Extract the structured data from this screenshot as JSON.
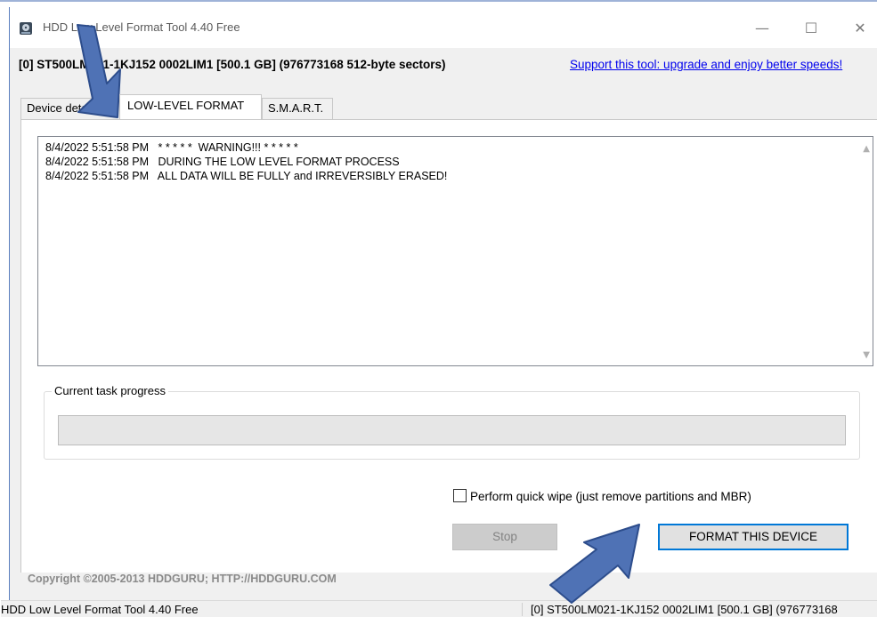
{
  "window": {
    "title": "HDD Low Level Format Tool 4.40   Free",
    "minimize": "—",
    "maximize": "☐",
    "close": "✕"
  },
  "device_info": {
    "text": "[0]  ST500LM021-1KJ152   0002LIM1   [500.1 GB]   (976773168 512-byte sectors)",
    "support_link": "Support this tool: upgrade and enjoy better speeds!"
  },
  "tabs": [
    {
      "label": "Device details"
    },
    {
      "label": "LOW-LEVEL FORMAT"
    },
    {
      "label": "S.M.A.R.T."
    }
  ],
  "log": {
    "lines": [
      "8/4/2022 5:51:58 PM   * * * * *  WARNING!!! * * * * *",
      "8/4/2022 5:51:58 PM   DURING THE LOW LEVEL FORMAT PROCESS",
      "8/4/2022 5:51:58 PM   ALL DATA WILL BE FULLY and IRREVERSIBLY ERASED!"
    ]
  },
  "progress": {
    "label": "Current task progress",
    "value_percent": 0
  },
  "options": {
    "quick_wipe_label": "Perform quick wipe (just remove partitions and MBR)",
    "quick_wipe_checked": false
  },
  "buttons": {
    "stop": "Stop",
    "format": "FORMAT THIS DEVICE"
  },
  "copyright": "Copyright ©2005-2013 HDDGURU;   HTTP://HDDGURU.COM",
  "statusbar": {
    "left": "HDD Low Level Format Tool 4.40   Free",
    "right": "[0]  ST500LM021-1KJ152   0002LIM1   [500.1 GB]   (976773168"
  },
  "colors": {
    "annotation_arrow": "#4f72b5",
    "link": "#0000ee",
    "focus_border": "#0078d7"
  },
  "icons": [
    "hdd-app-icon",
    "minimize-icon",
    "maximize-icon",
    "close-icon",
    "scroll-up-icon",
    "scroll-down-icon",
    "annotation-arrow-icon"
  ]
}
